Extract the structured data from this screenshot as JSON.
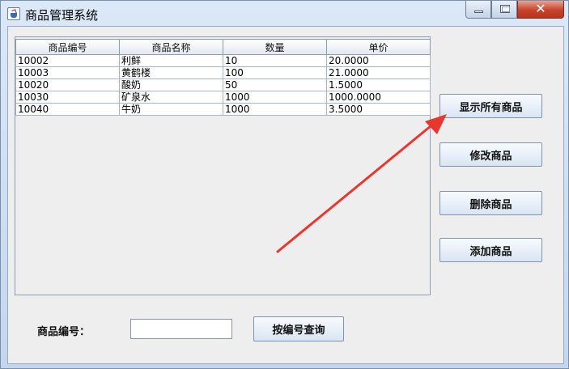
{
  "window": {
    "title": "商品管理系统"
  },
  "table": {
    "columns": [
      "商品编号",
      "商品名称",
      "数量",
      "单价"
    ],
    "rows": [
      [
        "10002",
        "利鲜",
        "10",
        "20.0000"
      ],
      [
        "10003",
        "黄鹤楼",
        "100",
        "21.0000"
      ],
      [
        "10020",
        "酸奶",
        "50",
        "1.5000"
      ],
      [
        "10030",
        "矿泉水",
        "1000",
        "1000.0000"
      ],
      [
        "10040",
        "牛奶",
        "1000",
        "3.5000"
      ]
    ]
  },
  "buttons": {
    "show_all": "显示所有商品",
    "modify": "修改商品",
    "delete": "删除商品",
    "add": "添加商品"
  },
  "query": {
    "label": "商品编号：",
    "input_value": "",
    "button": "按编号查询"
  },
  "annotation": {
    "arrow_color": "#e8372f"
  }
}
